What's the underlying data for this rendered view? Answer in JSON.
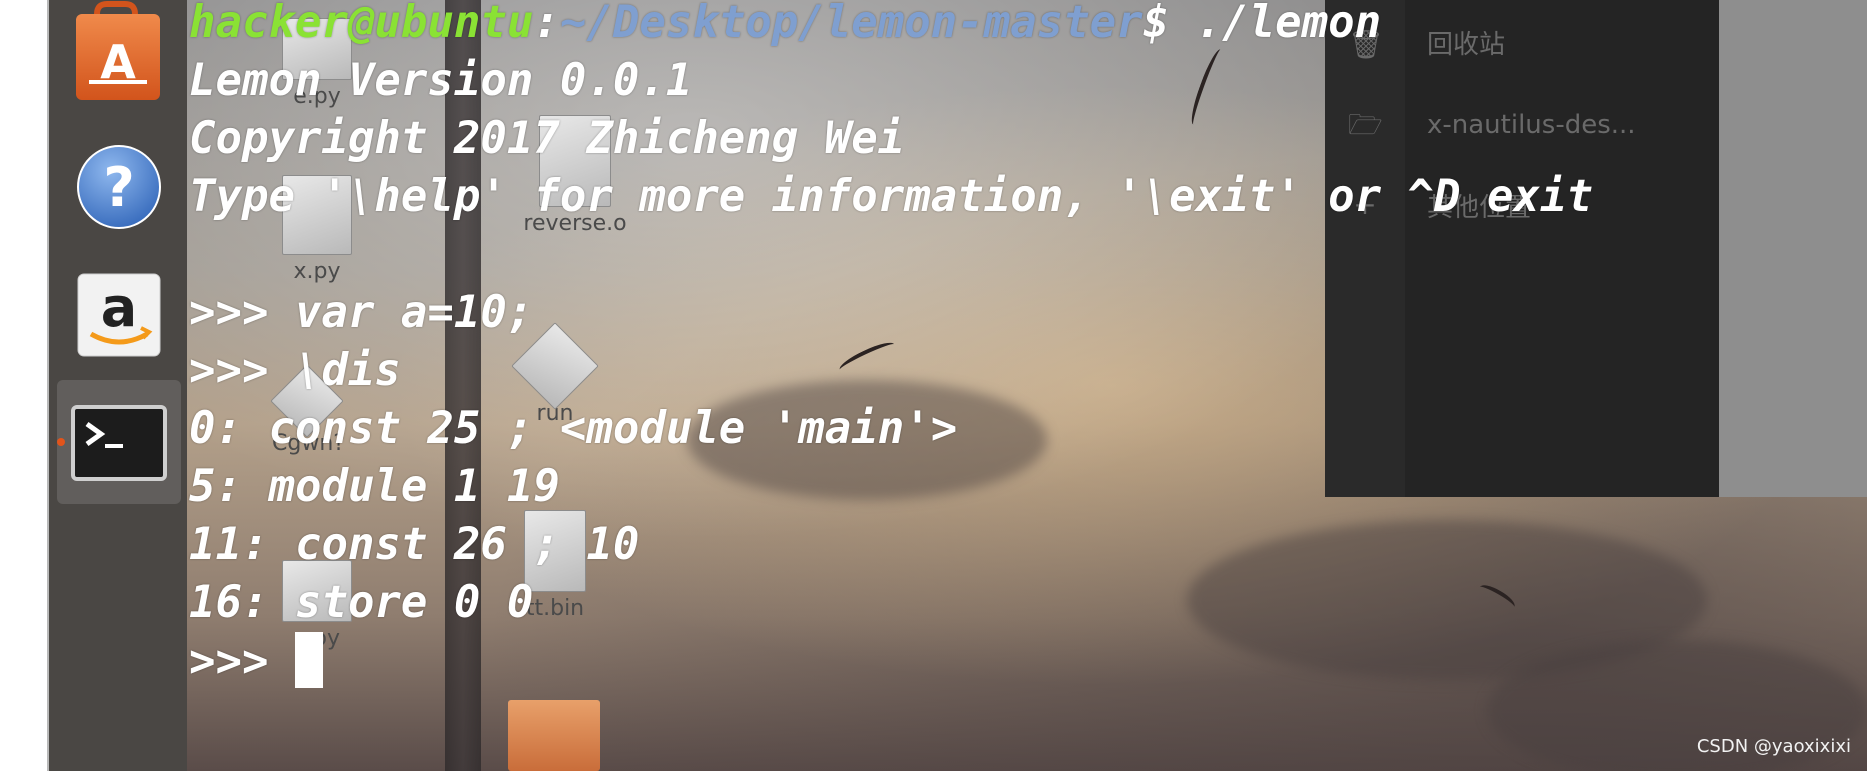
{
  "terminal": {
    "prompt_user": "hacker@ubuntu",
    "prompt_sep": ":",
    "prompt_path": "~/Desktop/lemon-master",
    "prompt_symbol": "$",
    "command": " ./lemon",
    "lines": [
      "Lemon Version 0.0.1",
      "Copyright 2017 Zhicheng Wei",
      "Type '\\help' for more information, '\\exit' or ^D exit",
      "",
      ">>> var a=10;",
      ">>> \\dis",
      "0: const 25 ; <module 'main'>",
      "5: module 1 19",
      "11: const 26 ; 10",
      "16: store 0 0"
    ],
    "current_prompt": ">>> "
  },
  "desktop": {
    "icons": [
      {
        "label": "e.py"
      },
      {
        "label": "reverse.o"
      },
      {
        "label": "x.py"
      },
      {
        "label": "run"
      },
      {
        "label": "Cgwn?"
      },
      {
        "label": "tt.bin"
      },
      {
        "label": "c.py"
      }
    ]
  },
  "files_panel": {
    "items": [
      {
        "label": "回收站",
        "icon": "trash-icon"
      },
      {
        "label": "x-nautilus-des...",
        "icon": "network-folder-icon"
      },
      {
        "label": "其他位置",
        "icon": "plus-icon"
      }
    ]
  },
  "launcher": {
    "items": [
      {
        "icon": "software-center-icon"
      },
      {
        "icon": "help-icon"
      },
      {
        "icon": "amazon-icon"
      },
      {
        "icon": "terminal-icon"
      }
    ]
  },
  "watermark": "CSDN @yaoxixixi",
  "colors": {
    "prompt_user": "#8ae234",
    "prompt_path": "#7f9fd0",
    "launcher_bg": "#4a4744",
    "active_indicator": "#e2541b"
  }
}
